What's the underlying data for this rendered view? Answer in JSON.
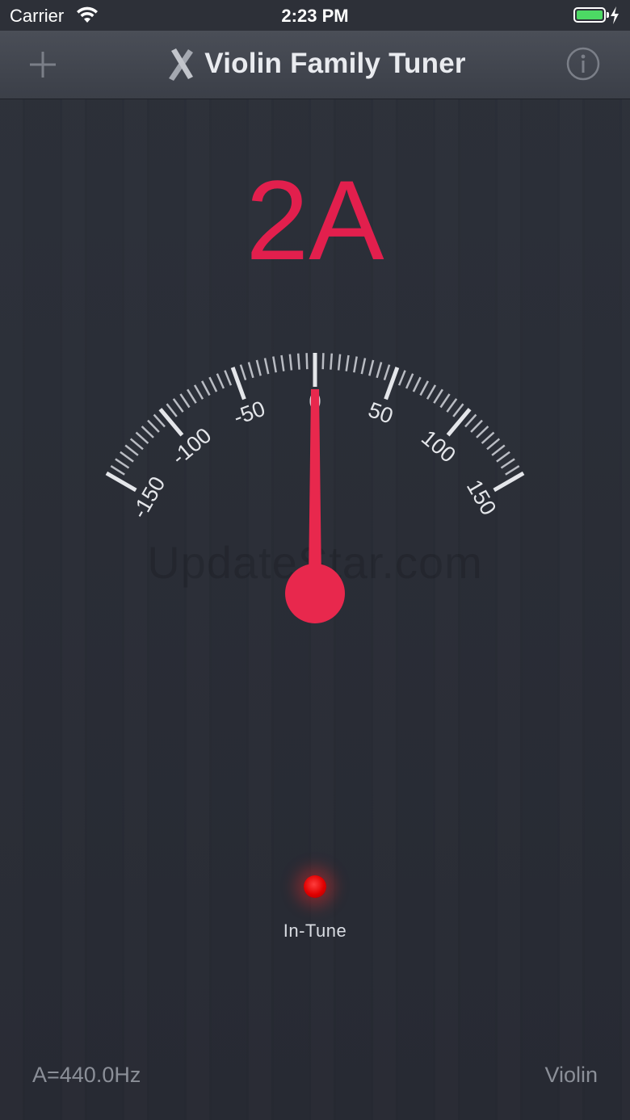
{
  "status_bar": {
    "carrier": "Carrier",
    "time": "2:23 PM"
  },
  "nav": {
    "title": "Violin Family Tuner"
  },
  "tuner": {
    "note": "2A",
    "needle_cents": 0,
    "scale_min": -150,
    "scale_max": 150,
    "major_labels": [
      "-150",
      "-100",
      "-50",
      "0",
      "50",
      "100",
      "150"
    ],
    "in_tune_label": "In-Tune"
  },
  "watermark": "UpdateStar.com",
  "footer": {
    "reference_pitch": "A=440.0Hz",
    "instrument": "Violin"
  },
  "colors": {
    "accent": "#e21f4d",
    "background": "#2a2e37",
    "indicator": "#ff1a1a"
  }
}
